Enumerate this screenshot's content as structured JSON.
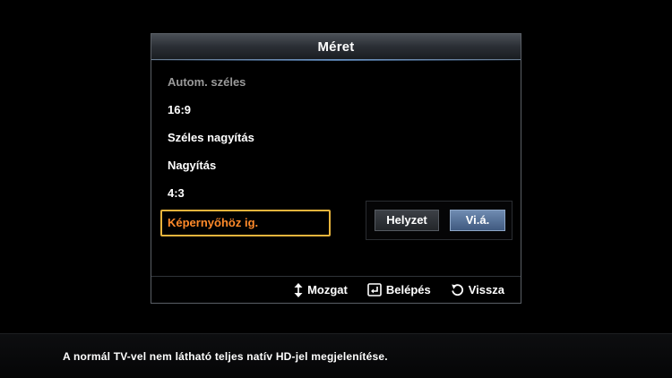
{
  "dialog": {
    "title": "Méret",
    "items": [
      {
        "label": "Autom. széles",
        "state": "disabled"
      },
      {
        "label": "16:9",
        "state": "normal"
      },
      {
        "label": "Széles nagyítás",
        "state": "normal"
      },
      {
        "label": "Nagyítás",
        "state": "normal"
      },
      {
        "label": "4:3",
        "state": "normal"
      },
      {
        "label": "Képernyőhöz ig.",
        "state": "selected"
      }
    ],
    "subpanel": {
      "position_label": "Helyzet",
      "reset_label": "Vi.á."
    },
    "footer": {
      "move_label": "Mozgat",
      "enter_label": "Belépés",
      "return_label": "Vissza",
      "move_icon": "updown-arrows-icon",
      "enter_icon": "enter-icon",
      "return_icon": "return-icon"
    }
  },
  "info": {
    "text": "A normál TV-vel nem látható teljes natív HD-jel megjelenítése."
  },
  "colors": {
    "selected_text": "#ff8a2a",
    "selected_border": "#e8b43c",
    "reset_button": "#5574a0"
  }
}
